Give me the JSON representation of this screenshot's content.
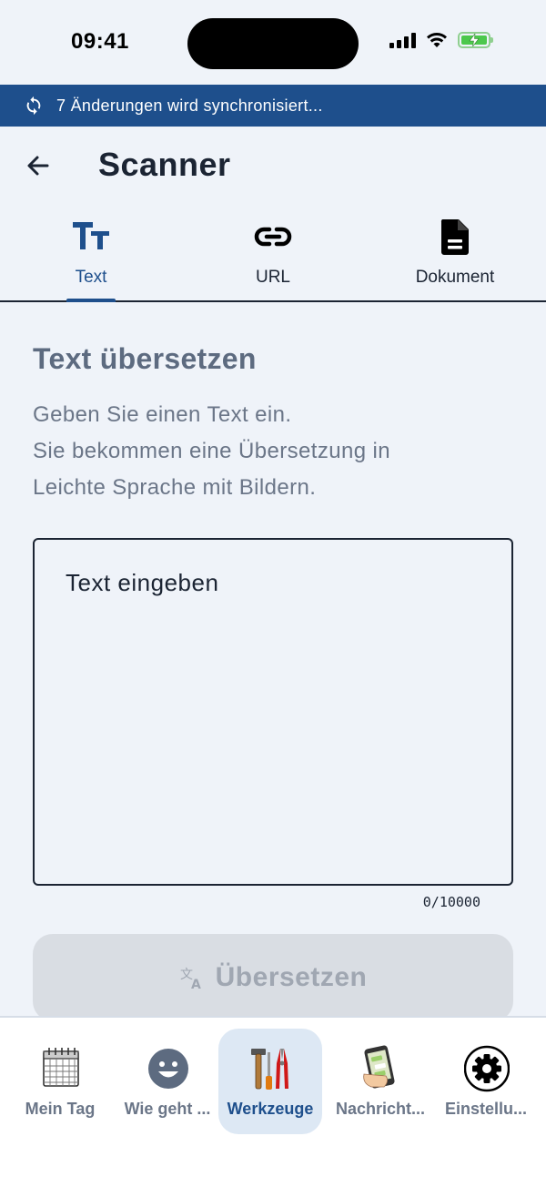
{
  "status_bar": {
    "time": "09:41",
    "icons": [
      "cellular-signal-icon",
      "wifi-icon",
      "battery-charging-icon"
    ]
  },
  "sync_banner": {
    "icon": "sync-icon",
    "text": "7 Änderungen wird synchronisiert..."
  },
  "header": {
    "back_icon": "arrow-left-icon",
    "title": "Scanner"
  },
  "tabs": [
    {
      "label": "Text",
      "icon": "text-format-icon",
      "active": true
    },
    {
      "label": "URL",
      "icon": "link-icon",
      "active": false
    },
    {
      "label": "Dokument",
      "icon": "document-icon",
      "active": false
    }
  ],
  "content": {
    "title": "Text übersetzen",
    "description_lines": [
      "Geben Sie einen Text ein.",
      "Sie bekommen eine Übersetzung in",
      "Leichte Sprache mit Bildern."
    ],
    "input": {
      "placeholder": "Text eingeben",
      "value": ""
    },
    "char_count": "0/10000",
    "translate_button": {
      "label": "Übersetzen",
      "icon": "translate-icon",
      "disabled": true
    }
  },
  "bottom_nav": [
    {
      "label": "Mein Tag",
      "icon": "calendar-icon",
      "active": false
    },
    {
      "label": "Wie geht ...",
      "icon": "smiley-icon",
      "active": false
    },
    {
      "label": "Werkzeuge",
      "icon": "tools-icon",
      "active": true
    },
    {
      "label": "Nachricht...",
      "icon": "phone-message-icon",
      "active": false
    },
    {
      "label": "Einstellu...",
      "icon": "gear-icon",
      "active": false
    }
  ],
  "colors": {
    "background": "#eff3f9",
    "primary": "#1e4f8c",
    "text": "#1b2433",
    "muted_text": "#6b7688",
    "button_disabled": "#d9dde3",
    "nav_active_bg": "#dde8f4"
  }
}
